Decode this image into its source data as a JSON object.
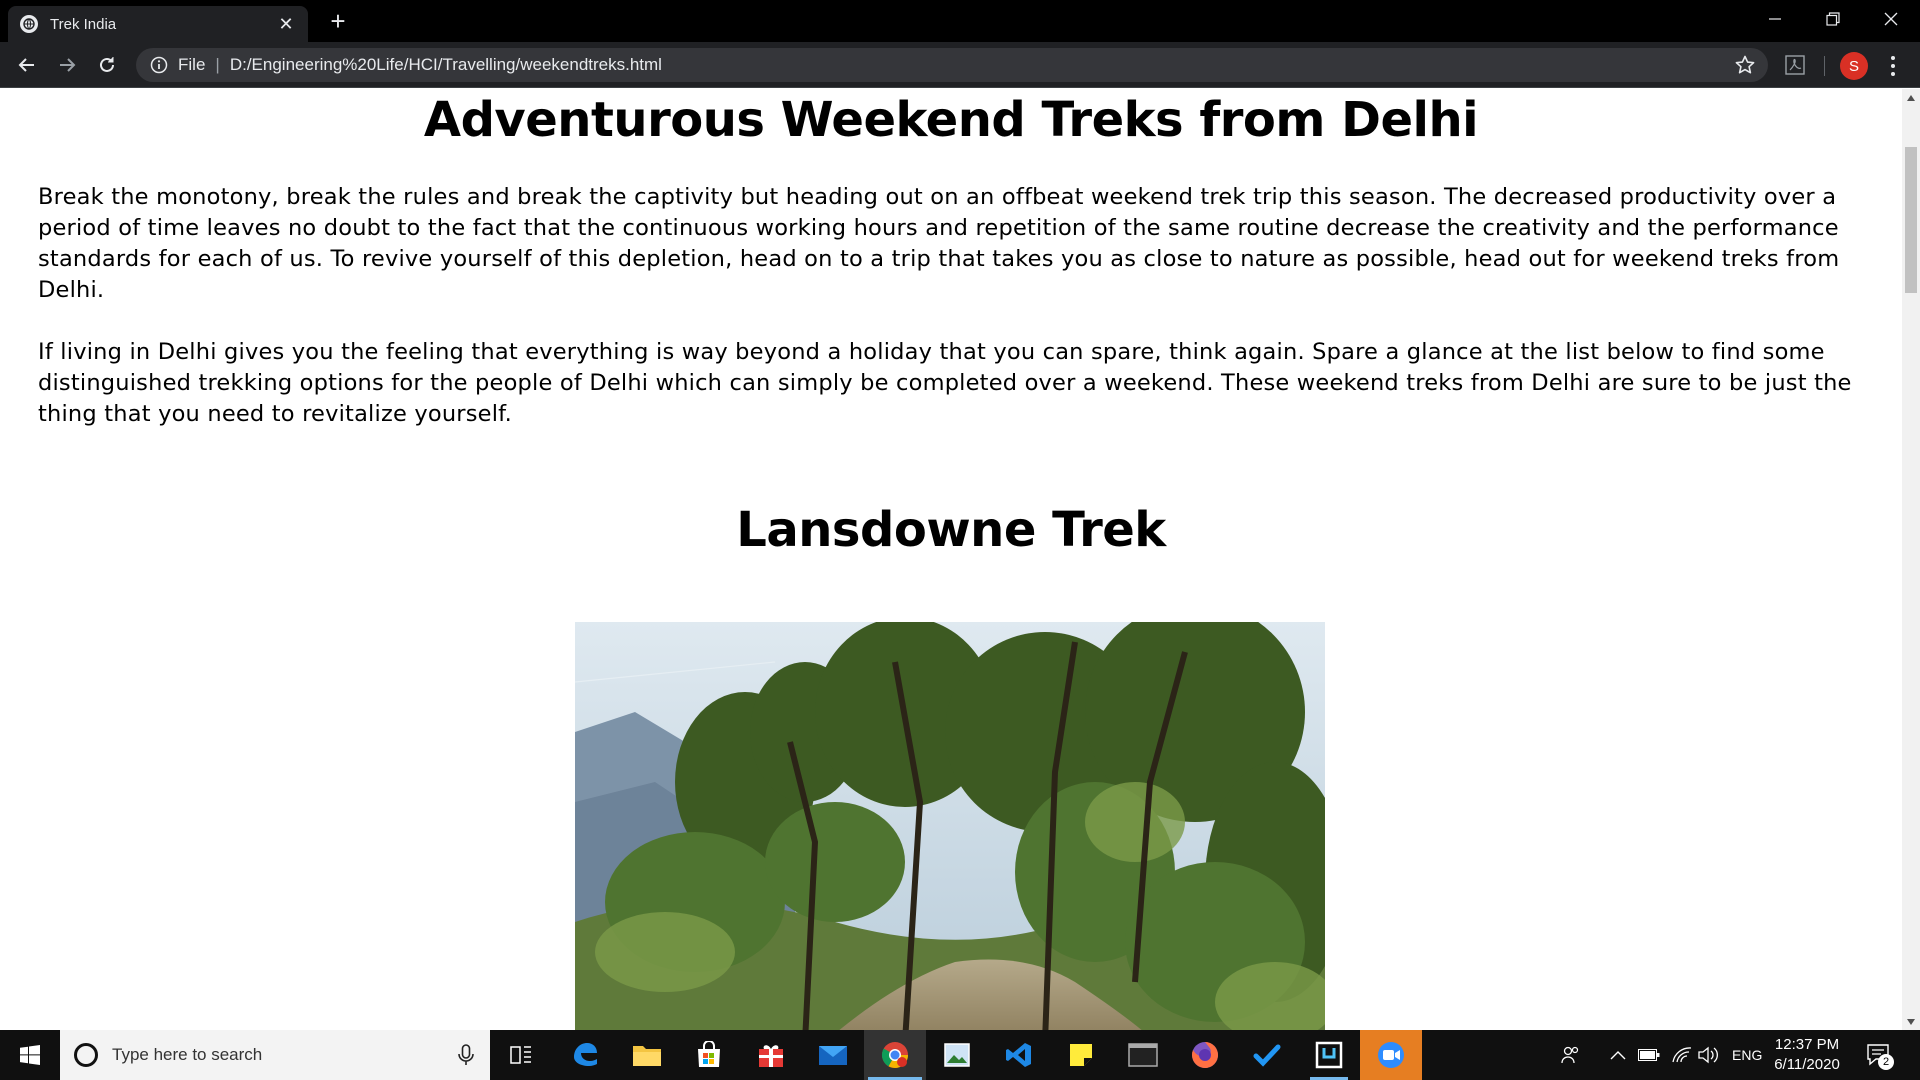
{
  "browser": {
    "tab_title": "Trek India",
    "tab_close": "✕",
    "new_tab": "+",
    "scheme_label": "File",
    "separator": "|",
    "url": "D:/Engineering%20Life/HCI/Travelling/weekendtreks.html",
    "profile_initial": "S"
  },
  "page": {
    "title": "Adventurous Weekend Treks from Delhi",
    "paragraphs": [
      "Break the monotony, break the rules and break the captivity but heading out on an offbeat weekend trek trip this season. The decreased productivity over a period of time leaves no doubt to the fact that the continuous working hours and repetition of the same routine decrease the creativity and the performance standards for each of us. To revive yourself of this depletion, head on to a trip that takes you as close to nature as possible, head out for weekend treks from Delhi.",
      "If living in Delhi gives you the feeling that everything is way beyond a holiday that you can spare, think again. Spare a glance at the list below to find some distinguished trekking options for the people of Delhi which can simply be completed over a weekend. These weekend treks from Delhi are sure to be just the thing that you need to revitalize yourself."
    ],
    "section_heading": "Lansdowne Trek"
  },
  "taskbar": {
    "search_placeholder": "Type here to search",
    "language": "ENG",
    "time": "12:37 PM",
    "date": "6/11/2020",
    "notification_count": "2"
  }
}
